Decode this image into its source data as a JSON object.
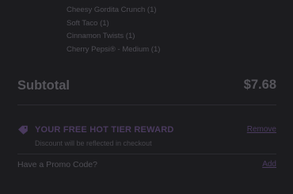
{
  "order": {
    "items": [
      "Cheesy Gordita Crunch (1)",
      "Soft Taco (1)",
      "Cinnamon Twists (1)",
      "Cherry Pepsi® - Medium (1)"
    ],
    "subtotal_label": "Subtotal",
    "subtotal_value": "$7.68"
  },
  "reward": {
    "icon": "tag-icon",
    "title": "YOUR FREE HOT TIER REWARD",
    "subtitle": "Discount will be reflected in checkout",
    "remove_label": "Remove"
  },
  "promo": {
    "label": "Have a Promo Code?",
    "add_label": "Add"
  },
  "colors": {
    "background": "#1b1b1d",
    "accent": "#4a3a5e",
    "text": "#56555b"
  }
}
